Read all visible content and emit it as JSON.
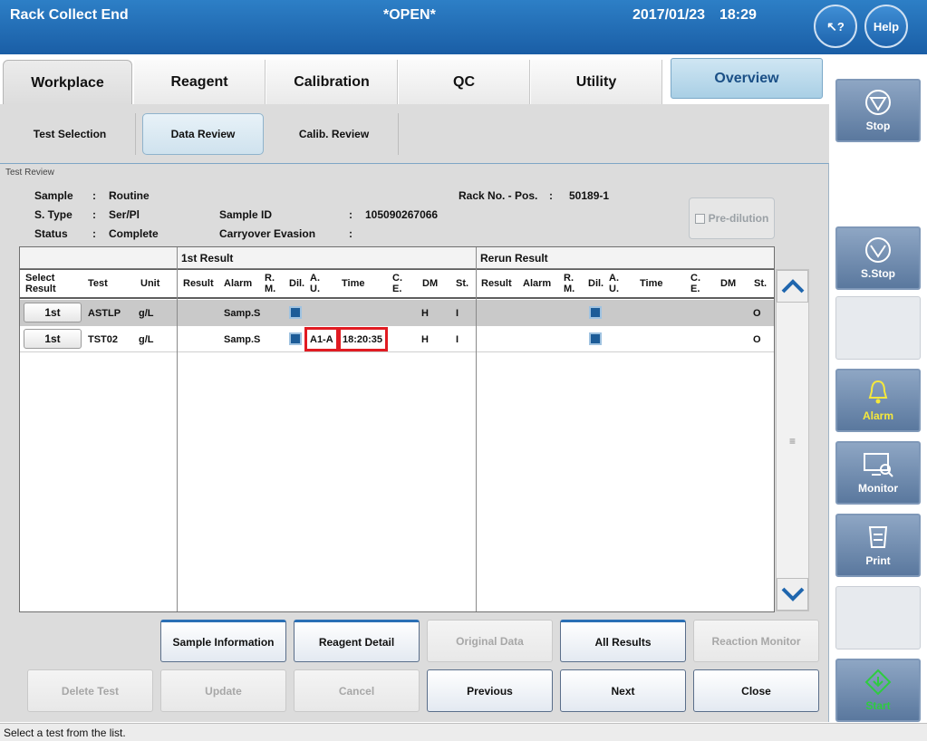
{
  "header": {
    "status": "Rack Collect End",
    "mode": "*OPEN*",
    "date": "2017/01/23",
    "time": "18:29",
    "context_help_label": "?",
    "help_label": "Help"
  },
  "main_tabs": [
    "Workplace",
    "Reagent",
    "Calibration",
    "QC",
    "Utility",
    "Overview"
  ],
  "sub_tabs": [
    "Test Selection",
    "Data Review",
    "Calib. Review"
  ],
  "panel": {
    "title": "Test Review",
    "sample_label": "Sample",
    "sample_value": "Routine",
    "stype_label": "S. Type",
    "stype_value": "Ser/Pl",
    "status_label": "Status",
    "status_value": "Complete",
    "sample_id_label": "Sample ID",
    "sample_id_value": "105090267066",
    "carryover_label": "Carryover Evasion",
    "rack_label": "Rack No. - Pos.",
    "rack_value": "50189-1",
    "colon": ":",
    "prediltion_label": "Pre-dilution"
  },
  "table": {
    "group_first": "1st Result",
    "group_rerun": "Rerun Result",
    "headers": {
      "select_result": "Select Result",
      "test": "Test",
      "unit": "Unit",
      "result": "Result",
      "alarm": "Alarm",
      "rm": "R. M.",
      "dil": "Dil.",
      "au": "A. U.",
      "time": "Time",
      "ce": "C. E.",
      "dm": "DM",
      "st": "St."
    },
    "rows": [
      {
        "select": "1st",
        "test": "ASTLP",
        "unit": "g/L",
        "alarm": "Samp.S",
        "au": "",
        "time": "",
        "dm": "H",
        "st": "I",
        "rerun_st": "O"
      },
      {
        "select": "1st",
        "test": "TST02",
        "unit": "g/L",
        "alarm": "Samp.S",
        "au": "A1-A",
        "time": "18:20:35",
        "dm": "H",
        "st": "I",
        "rerun_st": "O"
      }
    ]
  },
  "buttons": {
    "sample_information": "Sample Information",
    "reagent_detail": "Reagent Detail",
    "original_data": "Original Data",
    "all_results": "All Results",
    "reaction_monitor": "Reaction Monitor",
    "delete_test": "Delete Test",
    "update": "Update",
    "cancel": "Cancel",
    "previous": "Previous",
    "next": "Next",
    "close": "Close"
  },
  "side_buttons": {
    "stop": "Stop",
    "s_stop": "S.Stop",
    "alarm": "Alarm",
    "monitor": "Monitor",
    "print": "Print",
    "start": "Start"
  },
  "status_bar": "Select a test from the list.",
  "colors": {
    "header_blue": "#1f66ae",
    "highlight_red": "#e11b22",
    "alarm_yellow": "#f5e83c",
    "start_green": "#2ecc40"
  }
}
